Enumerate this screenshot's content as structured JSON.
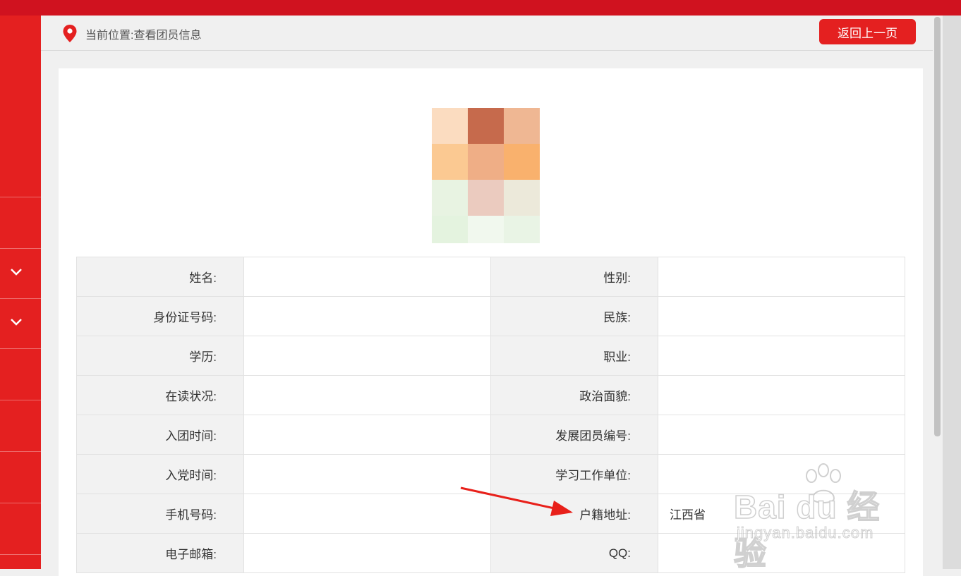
{
  "breadcrumb": {
    "text": "当前位置:查看团员信息"
  },
  "back_button": {
    "label": "返回上一页"
  },
  "rows": [
    {
      "left_label": "姓名:",
      "left_value": "",
      "right_label": "性别:",
      "right_value": ""
    },
    {
      "left_label": "身份证号码:",
      "left_value": "",
      "right_label": "民族:",
      "right_value": ""
    },
    {
      "left_label": "学历:",
      "left_value": "",
      "right_label": "职业:",
      "right_value": ""
    },
    {
      "left_label": "在读状况:",
      "left_value": "",
      "right_label": "政治面貌:",
      "right_value": ""
    },
    {
      "left_label": "入团时间:",
      "left_value": "",
      "right_label": "发展团员编号:",
      "right_value": ""
    },
    {
      "left_label": "入党时间:",
      "left_value": "",
      "right_label": "学习工作单位:",
      "right_value": ""
    },
    {
      "left_label": "手机号码:",
      "left_value": "",
      "right_label": "户籍地址:",
      "right_value": "江西省"
    },
    {
      "left_label": "电子邮箱:",
      "left_value": "",
      "right_label": "QQ:",
      "right_value": ""
    }
  ],
  "watermark": {
    "logo": "Bai du 经验",
    "url": "jingyan.baidu.com"
  },
  "colors": {
    "brand_red": "#e42020",
    "topbar_red": "#d0121f",
    "arrow_red": "#e8201a"
  },
  "icons": [
    "location-pin-icon",
    "chevron-down-icon",
    "baidu-paw-icon",
    "red-arrow-annotation"
  ]
}
